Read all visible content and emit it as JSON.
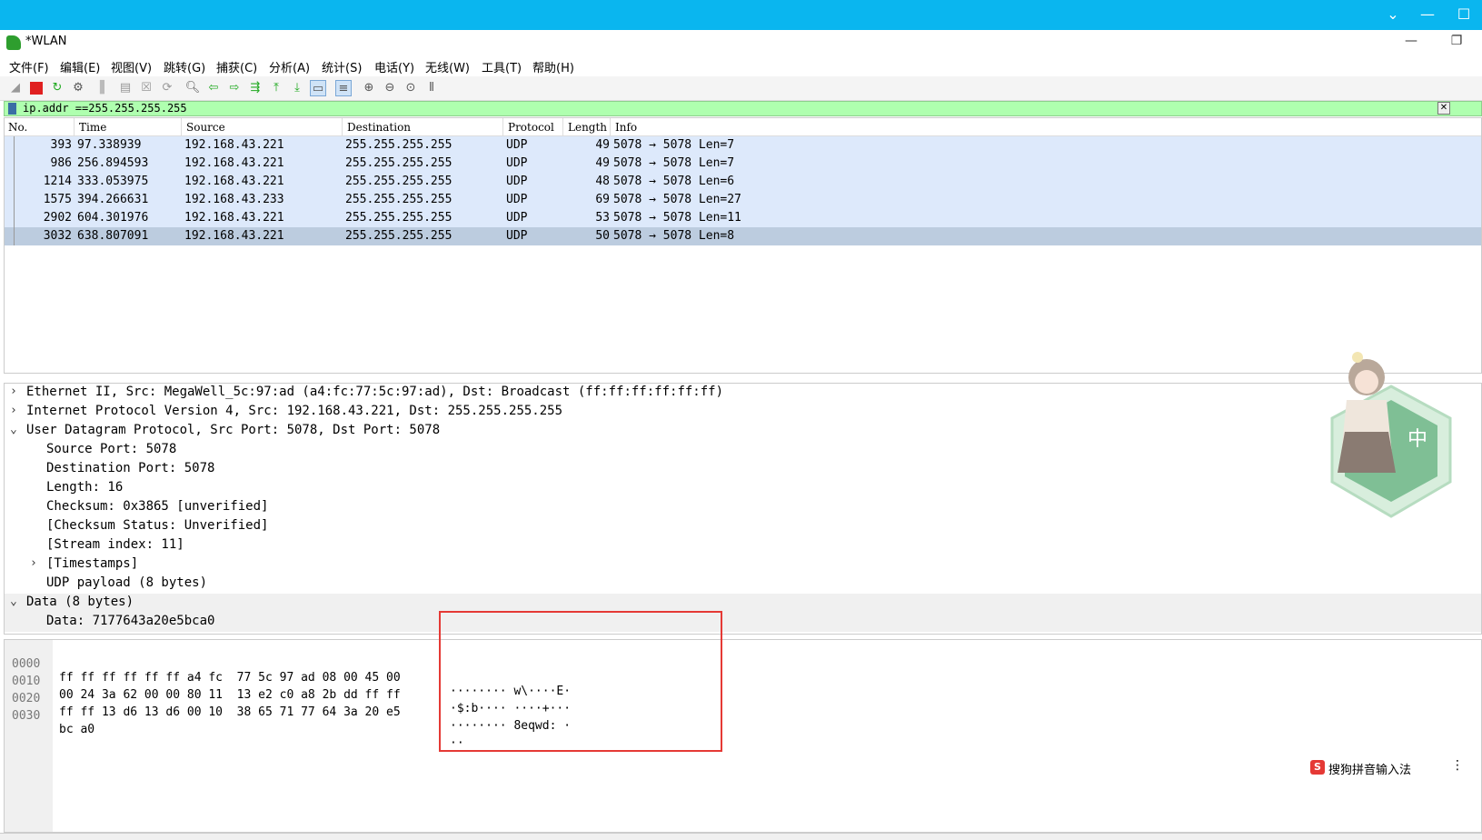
{
  "window": {
    "title": "*WLAN"
  },
  "menu": [
    "文件(F)",
    "编辑(E)",
    "视图(V)",
    "跳转(G)",
    "捕获(C)",
    "分析(A)",
    "统计(S)",
    "电话(Y)",
    "无线(W)",
    "工具(T)",
    "帮助(H)"
  ],
  "filter": {
    "value": "ip.addr ==255.255.255.255"
  },
  "packet_list": {
    "columns": [
      "No.",
      "Time",
      "Source",
      "Destination",
      "Protocol",
      "Length",
      "Info"
    ],
    "rows": [
      {
        "no": "393",
        "time": "97.338939",
        "src": "192.168.43.221",
        "dst": "255.255.255.255",
        "proto": "UDP",
        "len": "49",
        "info": "5078 → 5078 Len=7"
      },
      {
        "no": "986",
        "time": "256.894593",
        "src": "192.168.43.221",
        "dst": "255.255.255.255",
        "proto": "UDP",
        "len": "49",
        "info": "5078 → 5078 Len=7"
      },
      {
        "no": "1214",
        "time": "333.053975",
        "src": "192.168.43.221",
        "dst": "255.255.255.255",
        "proto": "UDP",
        "len": "48",
        "info": "5078 → 5078 Len=6"
      },
      {
        "no": "1575",
        "time": "394.266631",
        "src": "192.168.43.233",
        "dst": "255.255.255.255",
        "proto": "UDP",
        "len": "69",
        "info": "5078 → 5078 Len=27"
      },
      {
        "no": "2902",
        "time": "604.301976",
        "src": "192.168.43.221",
        "dst": "255.255.255.255",
        "proto": "UDP",
        "len": "53",
        "info": "5078 → 5078 Len=11"
      },
      {
        "no": "3032",
        "time": "638.807091",
        "src": "192.168.43.221",
        "dst": "255.255.255.255",
        "proto": "UDP",
        "len": "50",
        "info": "5078 → 5078 Len=8"
      }
    ]
  },
  "details": [
    {
      "arrow": ">",
      "text": "Ethernet II, Src: MegaWell_5c:97:ad (a4:fc:77:5c:97:ad), Dst: Broadcast (ff:ff:ff:ff:ff:ff)"
    },
    {
      "arrow": ">",
      "text": "Internet Protocol Version 4, Src: 192.168.43.221, Dst: 255.255.255.255"
    },
    {
      "arrow": "v",
      "text": "User Datagram Protocol, Src Port: 5078, Dst Port: 5078"
    },
    {
      "arrow": "",
      "text": "Source Port: 5078"
    },
    {
      "arrow": "",
      "text": "Destination Port: 5078"
    },
    {
      "arrow": "",
      "text": "Length: 16"
    },
    {
      "arrow": "",
      "text": "Checksum: 0x3865 [unverified]"
    },
    {
      "arrow": "",
      "text": "[Checksum Status: Unverified]"
    },
    {
      "arrow": "",
      "text": "[Stream index: 11]"
    },
    {
      "arrow": ">",
      "text": "[Timestamps]"
    },
    {
      "arrow": "",
      "text": "UDP payload (8 bytes)"
    },
    {
      "arrow": "v",
      "text": "Data (8 bytes)"
    },
    {
      "arrow": "",
      "text": "Data: 7177643a20e5bca0"
    }
  ],
  "bytes": [
    {
      "off": "0000",
      "hex": "ff ff ff ff ff ff a4 fc  77 5c 97 ad 08 00 45 00",
      "ascii": "········ w\\····E·"
    },
    {
      "off": "0010",
      "hex": "00 24 3a 62 00 00 80 11  13 e2 c0 a8 2b dd ff ff",
      "ascii": "·$:b···· ····+···"
    },
    {
      "off": "0020",
      "hex": "ff ff 13 d6 13 d6 00 10  38 65 71 77 64 3a 20 e5",
      "ascii": "········ 8eqwd: ·"
    },
    {
      "off": "0030",
      "hex": "bc a0",
      "ascii": "··"
    }
  ],
  "ime": {
    "label": "搜狗拼音输入法",
    "icon_text": "S"
  },
  "mascot": {
    "char": "中"
  },
  "colors": {
    "title_bar": "#0ab6ef",
    "filter_bg": "#afffaf",
    "row_bg": "#dde9fb",
    "row_selected": "#bcccdf",
    "highlight_box": "#e53935"
  }
}
